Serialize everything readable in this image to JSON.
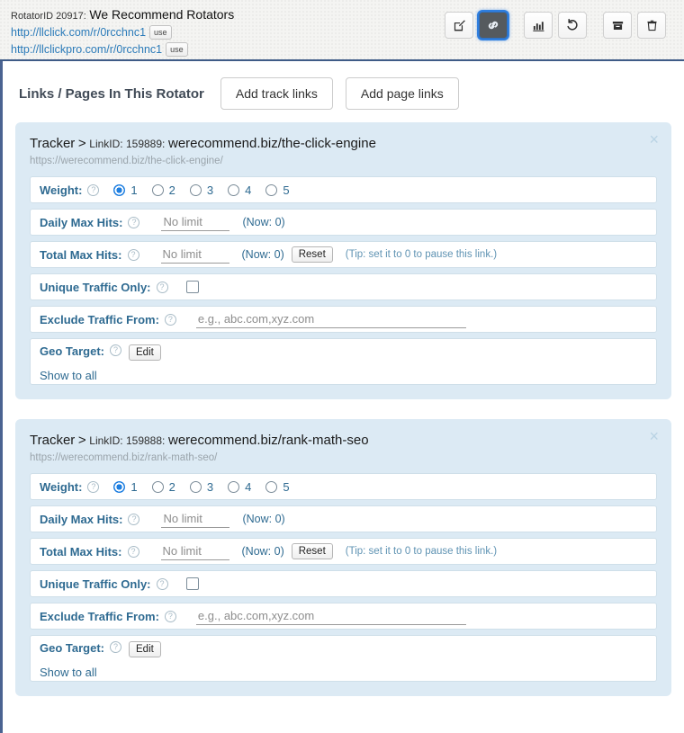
{
  "header": {
    "rotator_id_label": "RotatorID 20917:",
    "rotator_name": "We Recommend Rotators",
    "links": [
      {
        "url": "http://llclick.com/r/0rcchnc1",
        "use_label": "use"
      },
      {
        "url": "http://llclickpro.com/r/0rcchnc1",
        "use_label": "use"
      }
    ],
    "toolbar": [
      {
        "name": "edit-rotator-button",
        "icon": "pencil-square-icon",
        "active": false
      },
      {
        "name": "links-button",
        "icon": "link-chain-icon",
        "active": true
      },
      {
        "name": "stats-button",
        "icon": "bar-chart-icon",
        "active": false
      },
      {
        "name": "undo-button",
        "icon": "undo-arrow-icon",
        "active": false
      },
      {
        "name": "archive-button",
        "icon": "archive-box-icon",
        "active": false
      },
      {
        "name": "delete-button",
        "icon": "trash-icon",
        "active": false
      }
    ],
    "active_color": "#2f7fe0"
  },
  "section": {
    "title": "Links / Pages In This Rotator",
    "add_track_links": "Add track links",
    "add_page_links": "Add page links"
  },
  "field_labels": {
    "weight": "Weight:",
    "daily_max_hits": "Daily Max Hits:",
    "total_max_hits": "Total Max Hits:",
    "unique_traffic_only": "Unique Traffic Only:",
    "exclude_traffic_from": "Exclude Traffic From:",
    "geo_target": "Geo Target:",
    "help_glyph": "?",
    "close_glyph": "×",
    "reset_label": "Reset",
    "edit_label": "Edit",
    "tip": "(Tip: set it to 0 to pause this link.)",
    "no_limit_placeholder": "No limit",
    "exclude_placeholder": "e.g., abc.com,xyz.com"
  },
  "weight_options": [
    "1",
    "2",
    "3",
    "4",
    "5"
  ],
  "cards": [
    {
      "type_label": "Tracker",
      "separator": ">",
      "linkid_label": "LinkID: 159889:",
      "target": "werecommend.biz/the-click-engine",
      "url": "https://werecommend.biz/the-click-engine/",
      "weight_selected": "1",
      "daily_max_hits_value": "",
      "daily_now": "(Now: 0)",
      "total_max_hits_value": "",
      "total_now": "(Now: 0)",
      "unique_traffic_checked": false,
      "exclude_value": "",
      "geo_value": "Show to all"
    },
    {
      "type_label": "Tracker",
      "separator": ">",
      "linkid_label": "LinkID: 159888:",
      "target": "werecommend.biz/rank-math-seo",
      "url": "https://werecommend.biz/rank-math-seo/",
      "weight_selected": "1",
      "daily_max_hits_value": "",
      "daily_now": "(Now: 0)",
      "total_max_hits_value": "",
      "total_now": "(Now: 0)",
      "unique_traffic_checked": false,
      "exclude_value": "",
      "geo_value": "Show to all"
    }
  ]
}
